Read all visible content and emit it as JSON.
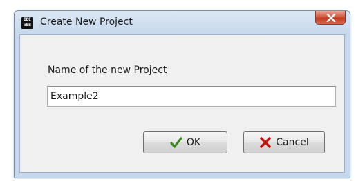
{
  "window": {
    "title": "Create New Project",
    "app_icon_text": [
      "IDE",
      "WEB"
    ]
  },
  "form": {
    "label": "Name of the new Project",
    "name_value": "Example2"
  },
  "buttons": {
    "ok_label": "OK",
    "cancel_label": "Cancel"
  },
  "colors": {
    "ok_check": "#3a8a1f",
    "cancel_x": "#c0140c",
    "close_button": "#c9452a"
  },
  "icons": {
    "close": "close-icon",
    "ok": "checkmark-icon",
    "cancel": "x-icon"
  }
}
